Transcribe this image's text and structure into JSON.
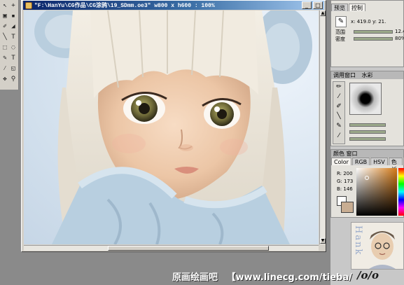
{
  "document": {
    "title": "\"F:\\HanYu\\CG作品\\CG涂鸦\\19_SDmm.oe3\" w800 x h600 : 100%",
    "minimize_label": "_",
    "maximize_label": "□",
    "close_label": "×"
  },
  "toolbox": {
    "tools": [
      "+",
      "▪",
      "◢",
      "T",
      "⬚",
      "✎",
      "⚲",
      "✥"
    ]
  },
  "tool_panel": {
    "tabs": [
      "预览",
      "控制"
    ],
    "active_tab": "控制",
    "coords": "x: 419.0  y: 21.",
    "range_label": "范围",
    "range_value": "12.4",
    "density_label": "密度",
    "density_value": "80%"
  },
  "brush_panel": {
    "title": "调用窗口",
    "subtitle": "水彩"
  },
  "color_panel": {
    "title": "颜色 窗口",
    "tabs": [
      "Color",
      "RGB",
      "HSV",
      "色板"
    ],
    "active_tab": "Color",
    "r": "R: 200",
    "g": "G: 173",
    "b": "B: 146",
    "current_color": "#c8ad92"
  },
  "watermark": {
    "site_cn": "原画绘画吧",
    "url": "【www.linecg.com/tieba/",
    "logo": "/o/o"
  },
  "avatar": {
    "text": "Hank"
  }
}
